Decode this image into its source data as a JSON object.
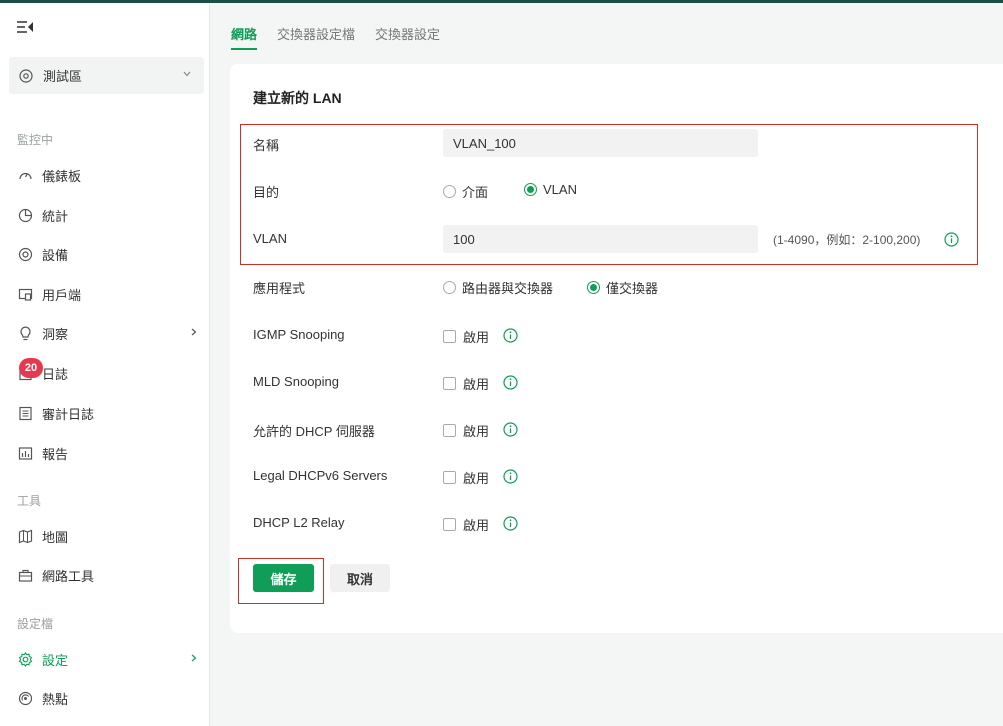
{
  "sidebar": {
    "site": "測試區",
    "sections": {
      "monitor": "監控中",
      "tools": "工具",
      "profiles": "設定檔"
    },
    "items": {
      "dashboard": "儀錶板",
      "stats": "統計",
      "devices": "設備",
      "clients": "用戶端",
      "insight": "洞察",
      "logs": "日誌",
      "audit_logs": "審計日誌",
      "reports": "報告",
      "map": "地圖",
      "net_tools": "網路工具",
      "settings": "設定",
      "hotspot": "熱點"
    },
    "logs_badge": "20"
  },
  "tabs": [
    "網路",
    "交換器設定檔",
    "交換器設定"
  ],
  "form": {
    "title": "建立新的 LAN",
    "name_label": "名稱",
    "name_value": "VLAN_100",
    "purpose_label": "目的",
    "purpose_options": [
      "介面",
      "VLAN"
    ],
    "purpose_selected": "VLAN",
    "vlan_label": "VLAN",
    "vlan_value": "100",
    "vlan_hint": "(1-4090，例如：2-100,200)",
    "app_label": "應用程式",
    "app_options": [
      "路由器與交換器",
      "僅交換器"
    ],
    "app_selected": "僅交換器",
    "options": [
      {
        "label": "IGMP Snooping",
        "check": "啟用"
      },
      {
        "label": "MLD Snooping",
        "check": "啟用"
      },
      {
        "label": "允許的 DHCP 伺服器",
        "check": "啟用"
      },
      {
        "label": "Legal DHCPv6 Servers",
        "check": "啟用"
      },
      {
        "label": "DHCP L2 Relay",
        "check": "啟用"
      }
    ],
    "save": "儲存",
    "cancel": "取消"
  },
  "colors": {
    "accent": "#0f9d58",
    "badge": "#e53950",
    "highlight": "#c9302c"
  },
  "icons": [
    "menu-collapse-icon",
    "location-icon",
    "chevron-down-icon",
    "gauge-icon",
    "pie-chart-icon",
    "target-icon",
    "client-icon",
    "bulb-icon",
    "log-icon",
    "list-icon",
    "report-icon",
    "map-icon",
    "toolbox-icon",
    "gear-icon",
    "hotspot-icon",
    "info-icon",
    "chevron-right-icon"
  ]
}
